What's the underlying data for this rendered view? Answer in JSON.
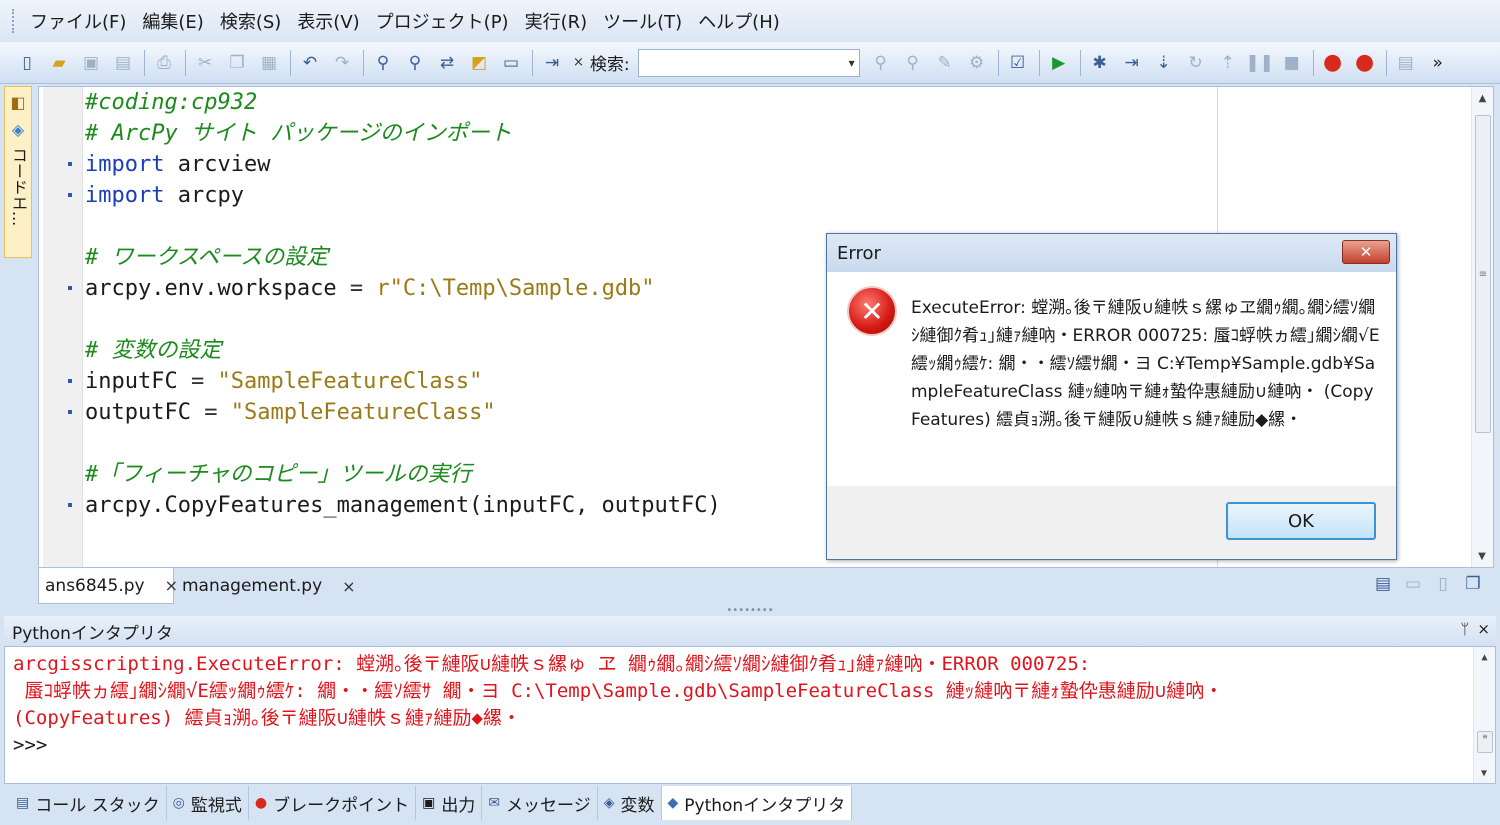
{
  "menu": {
    "items": [
      "ファイル(F)",
      "編集(E)",
      "検索(S)",
      "表示(V)",
      "プロジェクト(P)",
      "実行(R)",
      "ツール(T)",
      "ヘルプ(H)"
    ]
  },
  "toolbar": {
    "search_label": "検索:",
    "search_value": "",
    "search_dropdown_glyph": "▾",
    "close_glyph": "×",
    "more_glyph": "»"
  },
  "side_panel": {
    "label": "コードエ..."
  },
  "editor": {
    "lines": [
      {
        "parts": [
          [
            "comment",
            "#coding:cp932"
          ]
        ],
        "dot": false
      },
      {
        "parts": [
          [
            "comment",
            "# ArcPy サイト パッケージのインポート"
          ]
        ],
        "dot": false
      },
      {
        "parts": [
          [
            "kw",
            "import"
          ],
          [
            "id",
            " arcview"
          ]
        ],
        "dot": true
      },
      {
        "parts": [
          [
            "kw",
            "import"
          ],
          [
            "id",
            " arcpy"
          ]
        ],
        "dot": true
      },
      {
        "parts": [],
        "dot": false
      },
      {
        "parts": [
          [
            "comment",
            "# ワークスペースの設定"
          ]
        ],
        "dot": false
      },
      {
        "parts": [
          [
            "id",
            "arcpy.env.workspace "
          ],
          [
            "op",
            "="
          ],
          [
            "str",
            " r\"C:\\Temp\\Sample.gdb\""
          ]
        ],
        "dot": true
      },
      {
        "parts": [],
        "dot": false
      },
      {
        "parts": [
          [
            "comment",
            "# 変数の設定"
          ]
        ],
        "dot": false
      },
      {
        "parts": [
          [
            "id",
            "inputFC "
          ],
          [
            "op",
            "="
          ],
          [
            "str",
            " \"SampleFeatureClass\""
          ]
        ],
        "dot": true
      },
      {
        "parts": [
          [
            "id",
            "outputFC "
          ],
          [
            "op",
            "="
          ],
          [
            "str",
            " \"SampleFeatureClass\""
          ]
        ],
        "dot": true
      },
      {
        "parts": [],
        "dot": false
      },
      {
        "parts": [
          [
            "comment",
            "#「フィーチャのコピー」ツールの実行"
          ]
        ],
        "dot": false
      },
      {
        "parts": [
          [
            "id",
            "arcpy.CopyFeatures_management(inputFC, outputFC)"
          ]
        ],
        "dot": true
      }
    ]
  },
  "tabs": [
    {
      "label": "ans6845.py",
      "close": "×"
    },
    {
      "label": "management.py",
      "close": "×"
    }
  ],
  "interpreter": {
    "title": "Pythonインタプリタ",
    "pin": "ᛘ",
    "close": "×",
    "error_lines": [
      "arcgisscripting.ExecuteError: 螳溯｡後〒縺阪∪縺帙ｓ縲ゅ ヱ 繝ｩ繝｡繝ｼ繧ｿ繝ｼ縺御ｸ肴ｭ｣縺ｧ縺吶・ERROR 000725:",
      " 蜃ｺ蜉帙ヵ繧｣繝ｼ繝√Ε繧ｯ繝ｩ繧ｹ: 繝・・繧ｿ繧ｻ 繝・ヨ C:\\Temp\\Sample.gdb\\SampleFeatureClass 縺ｯ縺吶〒縺ｫ蟄伜惠縺励∪縺吶・",
      "(CopyFeatures) 繧貞ｮ溯｡後〒縺阪∪縺帙ｓ縺ｧ縺励◆縲・"
    ],
    "prompt": ">>>"
  },
  "bottom_tabs": [
    {
      "label": "コール スタック",
      "icon": "call-stack-icon"
    },
    {
      "label": "監視式",
      "icon": "watch-icon"
    },
    {
      "label": "ブレークポイント",
      "icon": "breakpoint-icon"
    },
    {
      "label": "出力",
      "icon": "output-icon"
    },
    {
      "label": "メッセージ",
      "icon": "message-icon"
    },
    {
      "label": "変数",
      "icon": "variables-icon"
    },
    {
      "label": "Pythonインタプリタ",
      "icon": "python-icon"
    }
  ],
  "dialog": {
    "title": "Error",
    "close_glyph": "✕",
    "message": "ExecuteError: 螳溯｡後〒縺阪∪縺帙ｓ縲ゅヱ繝ｩ繝｡繝ｼ繧ｿ繝ｼ縺御ｸ肴ｭ｣縺ｧ縺吶・ERROR 000725: 蜃ｺ蜉帙ヵ繧｣繝ｼ繝√Ε繧ｯ繝ｩ繧ｹ: 繝・・繧ｿ繧ｻ繝・ヨ C:¥Temp¥Sample.gdb¥SampleFeatureClass 縺ｯ縺吶〒縺ｫ蟄伜惠縺励∪縺吶・ (CopyFeatures) 繧貞ｮ溯｡後〒縺阪∪縺帙ｓ縺ｧ縺励◆縲・",
    "ok_label": "OK"
  },
  "colors": {
    "comment": "#1c8a1c",
    "keyword": "#1a3fb8",
    "string": "#9a7a16",
    "error_text": "#e0141c"
  }
}
